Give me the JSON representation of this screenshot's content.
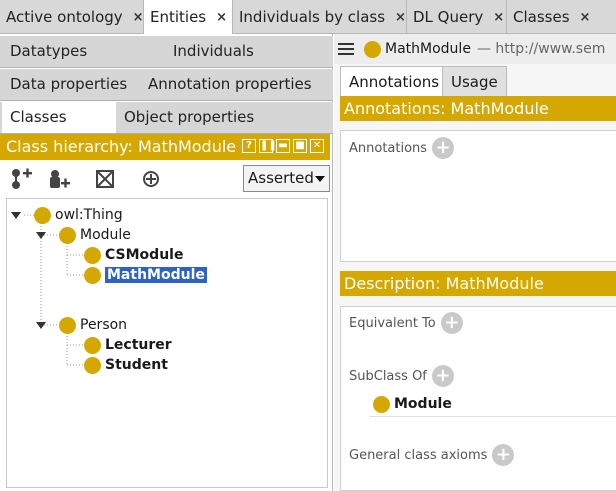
{
  "tabs": [
    {
      "label": "Active ontology",
      "close": "×",
      "active": false
    },
    {
      "label": "Entities",
      "close": "×",
      "active": true
    },
    {
      "label": "Individuals by class",
      "close": "×",
      "active": false
    },
    {
      "label": "DL Query",
      "close": "×",
      "active": false
    },
    {
      "label": "Classes",
      "close": "×",
      "active": false
    }
  ],
  "left": {
    "tab_rows": [
      [
        "Datatypes",
        "Individuals"
      ],
      [
        "Data properties",
        "Annotation properties"
      ],
      [
        "Classes",
        "Object properties"
      ]
    ],
    "selected_tab": "Classes",
    "hierarchy_title": "Class hierarchy: MathModule",
    "header_buttons": [
      "?",
      "❚❚",
      "▬",
      "■",
      "✕"
    ],
    "toolbar_icons": [
      "add-subclass-icon",
      "add-sibling-class-icon",
      "delete-class-icon",
      "target-icon"
    ],
    "view_select": "Asserted",
    "tree": {
      "root": "owl:Thing",
      "module": "Module",
      "cs_module": "CSModule",
      "math_module": "MathModule",
      "person": "Person",
      "lecturer": "Lecturer",
      "student": "Student"
    }
  },
  "right": {
    "header_title": "MathModule",
    "header_suffix": "— http://www.sem",
    "tabs": [
      "Annotations",
      "Usage"
    ],
    "annotations_header": "Annotations: MathModule",
    "annotations_label": "Annotations",
    "description_header": "Description: MathModule",
    "equivalent_label": "Equivalent To",
    "subclass_label": "SubClass Of",
    "subclass_value": "Module",
    "general_axioms_label": "General class axioms",
    "plus": "+"
  },
  "colors": {
    "accent": "#d4a800",
    "selection": "#2f63c0",
    "tabbar": "#d8d8d8"
  }
}
